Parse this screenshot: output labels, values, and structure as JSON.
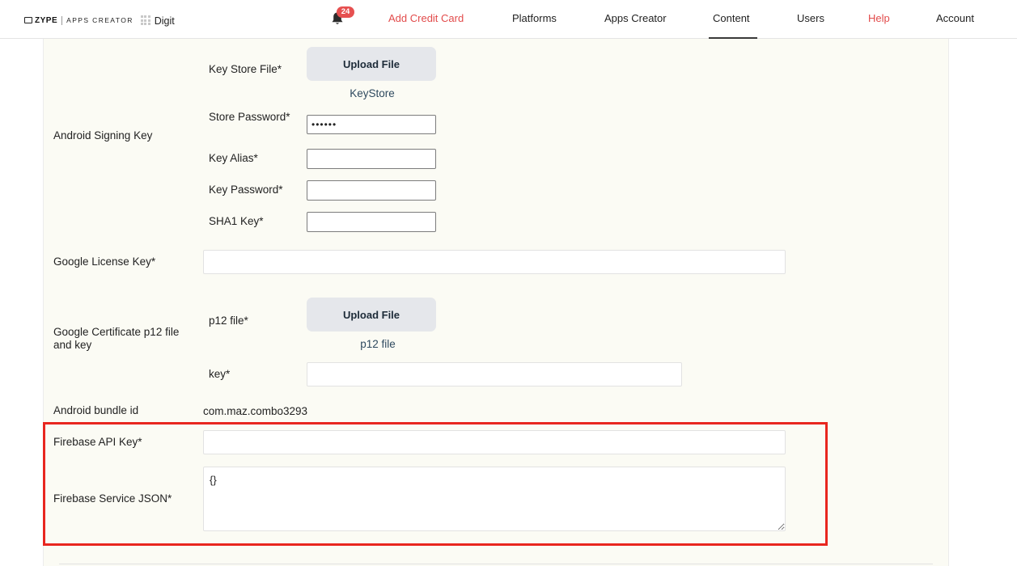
{
  "header": {
    "logo": {
      "brand": "ZYPE",
      "product": "APPS CREATOR",
      "workspace": "Digit"
    },
    "notifications": {
      "count": "24"
    },
    "nav": [
      {
        "label": "Add Credit Card"
      },
      {
        "label": "Platforms"
      },
      {
        "label": "Apps Creator"
      },
      {
        "label": "Content"
      },
      {
        "label": "Users"
      },
      {
        "label": "Help"
      },
      {
        "label": "Account"
      }
    ],
    "active_nav": "Content",
    "accent_red": "#e24b4b"
  },
  "form": {
    "android_signing": {
      "section_label": "Android Signing Key",
      "key_store_file": {
        "label": "Key Store File*",
        "button": "Upload File",
        "caption": "KeyStore"
      },
      "store_password": {
        "label": "Store Password*",
        "value": "••••••"
      },
      "key_alias": {
        "label": "Key Alias*",
        "value": ""
      },
      "key_password": {
        "label": "Key Password*",
        "value": ""
      },
      "sha1_key": {
        "label": "SHA1 Key*",
        "value": ""
      }
    },
    "google_license_key": {
      "label": "Google License Key*",
      "value": ""
    },
    "google_certificate": {
      "section_label": "Google Certificate p12 file and key",
      "p12_file": {
        "label": "p12 file*",
        "button": "Upload File",
        "caption": "p12 file"
      },
      "key": {
        "label": "key*",
        "value": ""
      }
    },
    "android_bundle_id": {
      "label": "Android bundle id",
      "value": "com.maz.combo3293"
    },
    "firebase_api_key": {
      "label": "Firebase API Key*",
      "value": ""
    },
    "firebase_service_json": {
      "label": "Firebase Service JSON*",
      "value": "{}"
    },
    "highlight_color": "#e8261f"
  }
}
